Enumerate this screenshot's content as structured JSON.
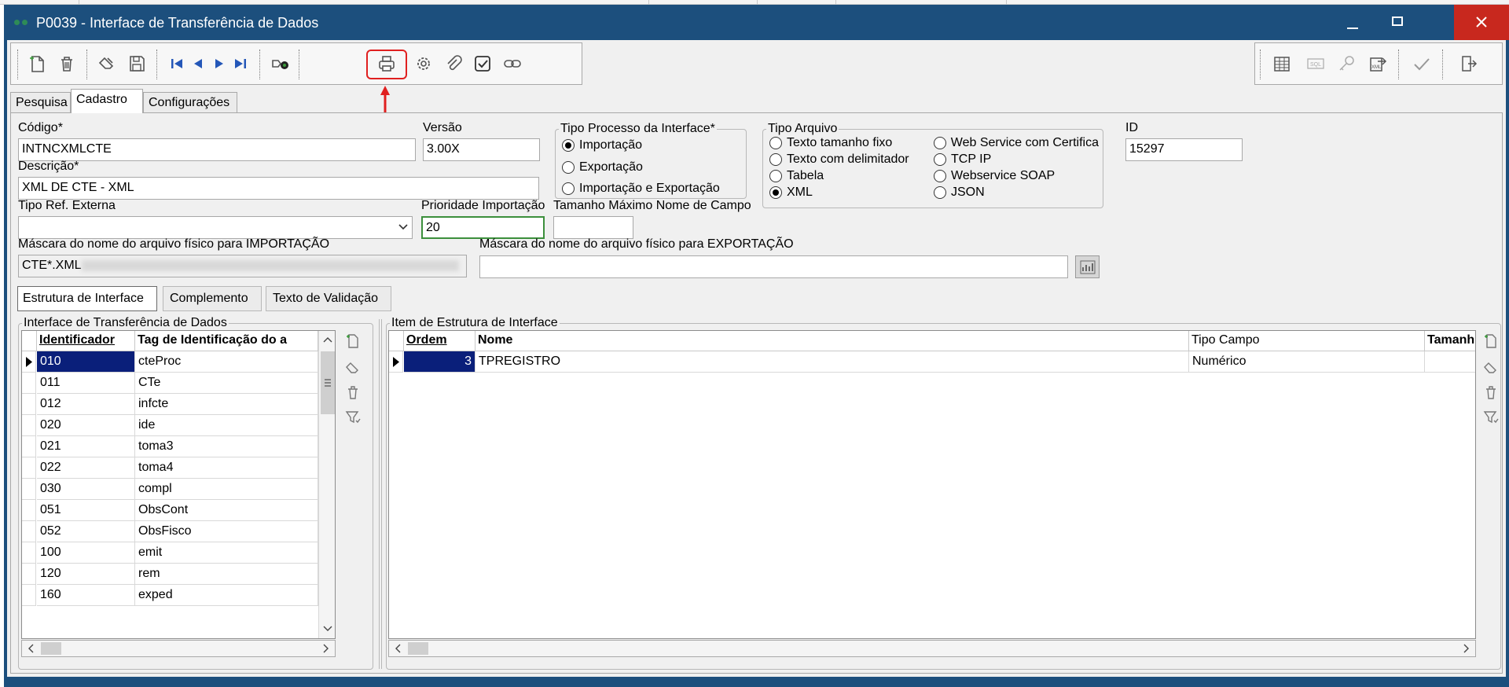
{
  "window": {
    "title": "P0039 - Interface de Transferência de Dados",
    "min_icon": "minimize-icon",
    "max_icon": "maximize-icon",
    "close_icon": "close-icon"
  },
  "main_tabs": [
    "Pesquisa",
    "Cadastro",
    "Configurações"
  ],
  "form": {
    "codigo_label": "Código*",
    "codigo_value": "INTNCXMLCTE",
    "versao_label": "Versão",
    "versao_value": "3.00X",
    "descricao_label": "Descrição*",
    "descricao_value": "XML DE CTE - XML",
    "tipo_processo": {
      "title": "Tipo Processo da Interface*",
      "options": [
        "Importação",
        "Exportação",
        "Importação e Exportação"
      ],
      "selected": "Importação"
    },
    "tipo_arquivo": {
      "title": "Tipo Arquivo",
      "options": [
        "Texto tamanho fixo",
        "Texto com delimitador",
        "Tabela",
        "XML",
        "Web Service com Certifica",
        "TCP IP",
        "Webservice SOAP",
        "JSON"
      ],
      "selected": "XML"
    },
    "id_label": "ID",
    "id_value": "15297",
    "tipo_ref_label": "Tipo Ref. Externa",
    "tipo_ref_value": "",
    "prioridade_label": "Prioridade Importação",
    "prioridade_value": "20",
    "tamanho_label": "Tamanho Máximo Nome de Campo",
    "tamanho_value": "",
    "mascara_imp_label": "Máscara do nome do arquivo físico para IMPORTAÇÃO",
    "mascara_imp_value": "CTE*.XML",
    "mascara_exp_label": "Máscara do nome do arquivo físico para EXPORTAÇÃO",
    "mascara_exp_value": ""
  },
  "sub_tabs": [
    "Estrutura de Interface",
    "Complemento",
    "Texto de Validação"
  ],
  "left_panel": {
    "title": "Interface de Transferência de Dados",
    "columns": [
      "Identificador",
      "Tag de Identificação do a"
    ],
    "rows": [
      {
        "id": "010",
        "tag": "cteProc"
      },
      {
        "id": "011",
        "tag": "CTe"
      },
      {
        "id": "012",
        "tag": "infcte"
      },
      {
        "id": "020",
        "tag": "ide"
      },
      {
        "id": "021",
        "tag": "toma3"
      },
      {
        "id": "022",
        "tag": "toma4"
      },
      {
        "id": "030",
        "tag": "compl"
      },
      {
        "id": "051",
        "tag": "ObsCont"
      },
      {
        "id": "052",
        "tag": "ObsFisco"
      },
      {
        "id": "100",
        "tag": "emit"
      },
      {
        "id": "120",
        "tag": "rem"
      },
      {
        "id": "160",
        "tag": "exped"
      }
    ]
  },
  "right_panel": {
    "title": "Item de Estrutura de Interface",
    "columns": [
      "Ordem",
      "Nome",
      "Tipo Campo",
      "Tamanh"
    ],
    "rows": [
      {
        "ordem": "3",
        "nome": "TPREGISTRO",
        "tipo": "Numérico",
        "tamanho": ""
      }
    ]
  },
  "colors": {
    "titlebar": "#1c4f7d",
    "close": "#c8281e",
    "selection": "#0a1f7a",
    "highlight": "#e02020"
  }
}
